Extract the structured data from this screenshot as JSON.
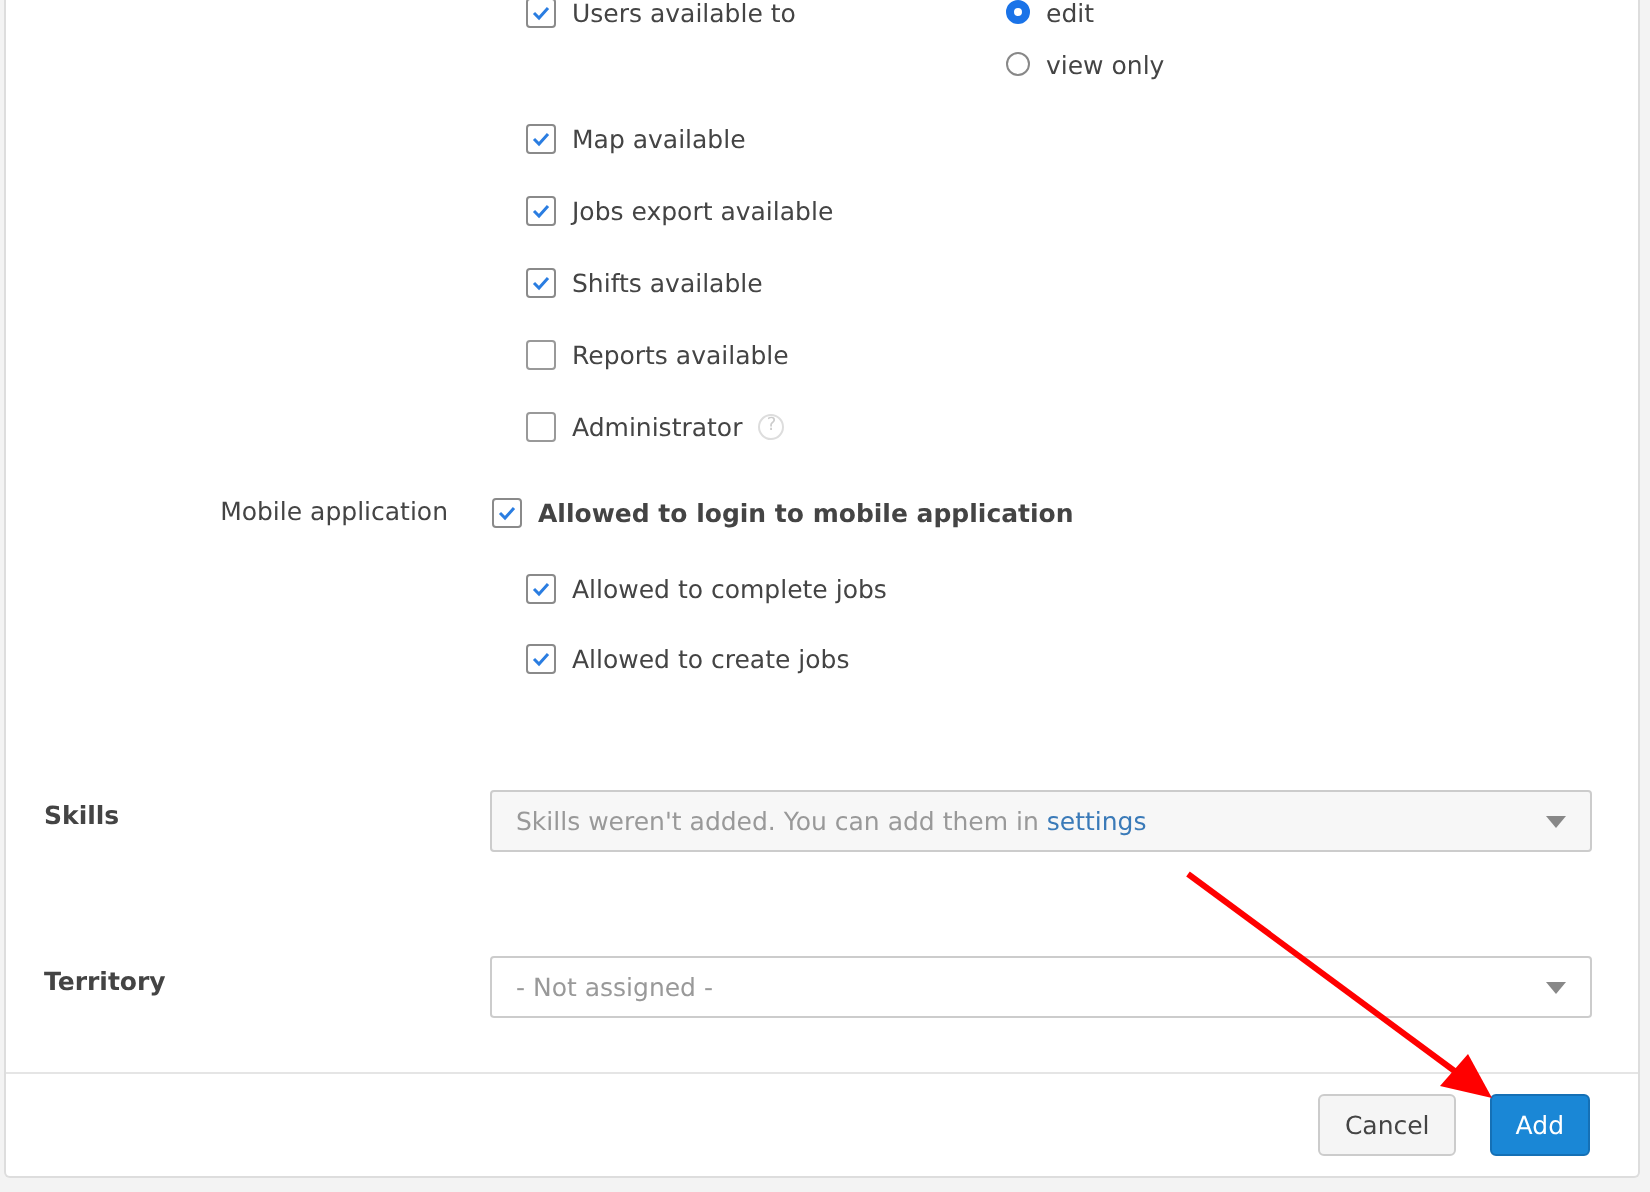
{
  "permissions": [
    {
      "label": "Users available to",
      "checked": true,
      "options": [
        {
          "label": "edit",
          "selected": true
        },
        {
          "label": "view only",
          "selected": false
        }
      ]
    },
    {
      "label": "Map available",
      "checked": true
    },
    {
      "label": "Jobs export available",
      "checked": true
    },
    {
      "label": "Shifts available",
      "checked": true
    },
    {
      "label": "Reports available",
      "checked": false
    },
    {
      "label": "Administrator",
      "checked": false,
      "help": "?"
    }
  ],
  "mobile": {
    "label": "Mobile application",
    "main": {
      "label": "Allowed to login to mobile application",
      "checked": true
    },
    "items": [
      {
        "label": "Allowed to complete jobs",
        "checked": true
      },
      {
        "label": "Allowed to create jobs",
        "checked": true
      }
    ]
  },
  "fields": [
    {
      "label": "Skills",
      "kind": "notice",
      "text": "Skills weren't added. You can add them in",
      "link": "settings"
    },
    {
      "label": "Territory",
      "kind": "select",
      "value": "- Not assigned -"
    }
  ],
  "buttons": [
    {
      "label": "Cancel",
      "kind": "secondary"
    },
    {
      "label": "Add",
      "kind": "primary"
    }
  ]
}
